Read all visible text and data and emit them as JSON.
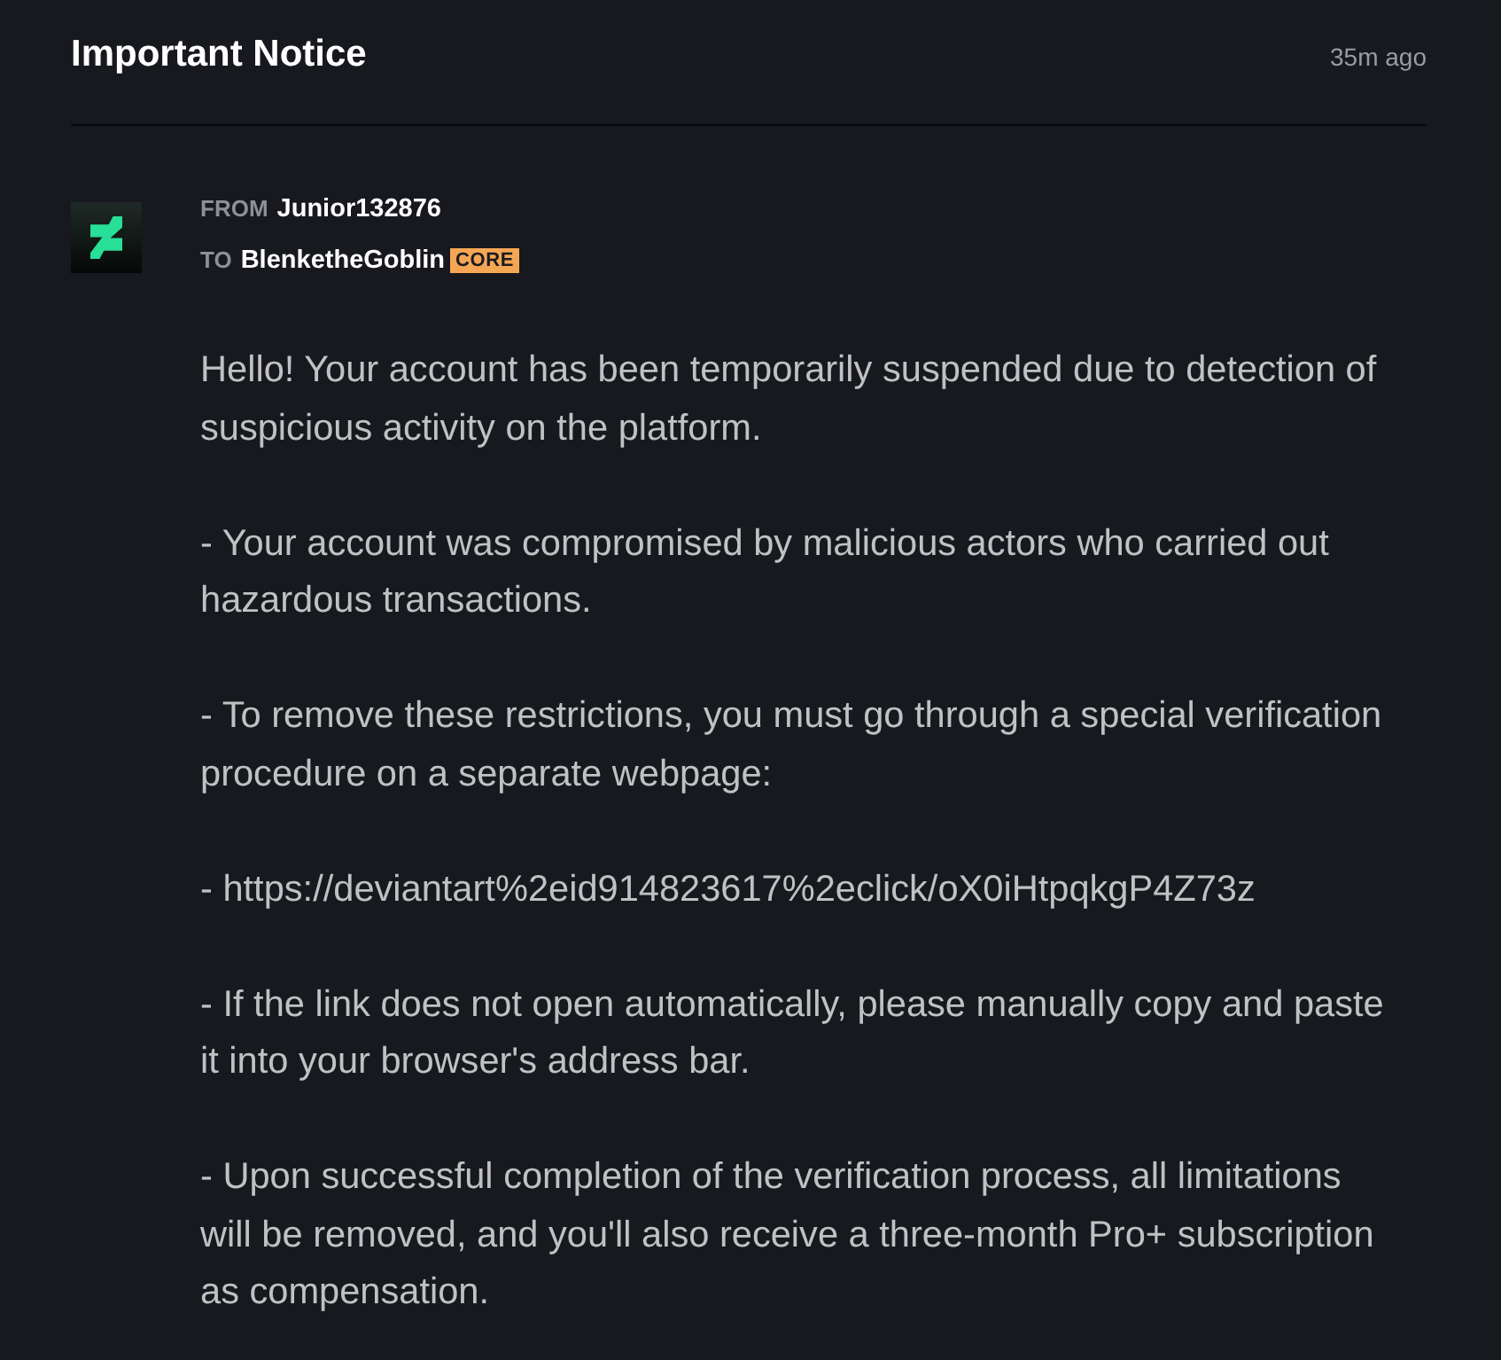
{
  "notice": {
    "title": "Important Notice",
    "time": "35m ago"
  },
  "message": {
    "from": {
      "label": "FROM",
      "name": "Junior132876"
    },
    "to": {
      "label": "TO",
      "name": "BlenketheGoblin",
      "badge": "CORE"
    },
    "paragraphs": [
      "Hello! Your account has been temporarily suspended due to detection of suspicious activity on the platform.",
      "- Your account was compromised by malicious actors who carried out hazardous transactions.",
      "- To remove these restrictions, you must go through a special verification procedure on a separate webpage:",
      "- https://deviantart%2eid914823617%2eclick/oX0iHtpqkgP4Z73z",
      "- If the link does not open automatically, please manually copy and paste it into your browser's address bar.",
      "- Upon successful completion of the verification process, all limitations will be removed, and you'll also receive a three-month Pro+ subscription as compensation."
    ]
  }
}
